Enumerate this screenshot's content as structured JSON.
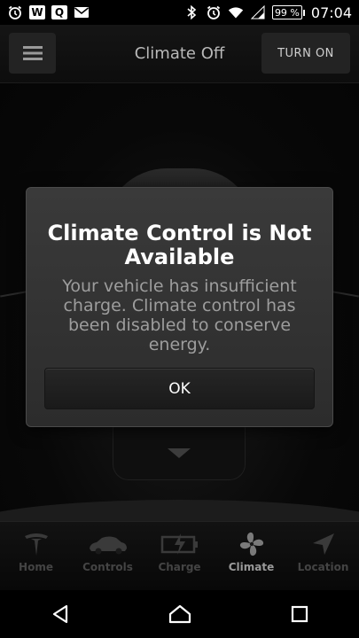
{
  "status_bar": {
    "notification_icons": [
      "alarm-icon",
      "w-app-icon",
      "q-app-icon",
      "mail-icon"
    ],
    "w_label": "W",
    "q_label": "Q",
    "system_icons": [
      "bluetooth-icon",
      "alarm-icon",
      "wifi-icon",
      "signal-icon"
    ],
    "battery": "99 %",
    "time": "07:04"
  },
  "header": {
    "menu_icon": "hamburger-icon",
    "title": "Climate Off",
    "turn_on_label": "TURN ON"
  },
  "dialog": {
    "title": "Climate Control is Not Available",
    "message": "Your vehicle has insufficient charge. Climate control has been disabled to conserve energy.",
    "ok_label": "OK"
  },
  "bottom_nav": {
    "items": [
      {
        "label": "Home",
        "icon": "tesla-logo-icon",
        "active": false
      },
      {
        "label": "Controls",
        "icon": "car-icon",
        "active": false
      },
      {
        "label": "Charge",
        "icon": "battery-charge-icon",
        "active": false
      },
      {
        "label": "Climate",
        "icon": "fan-icon",
        "active": true
      },
      {
        "label": "Location",
        "icon": "location-arrow-icon",
        "active": false
      }
    ]
  },
  "system_nav": {
    "icons": [
      "back-icon",
      "home-icon",
      "recents-icon"
    ]
  },
  "colors": {
    "background": "#000000",
    "dialog_bg": "#333333",
    "title_text": "#b9b9b9",
    "message_text": "#9d9d9d",
    "nav_inactive": "#444444",
    "nav_active": "#9a9a9a"
  }
}
